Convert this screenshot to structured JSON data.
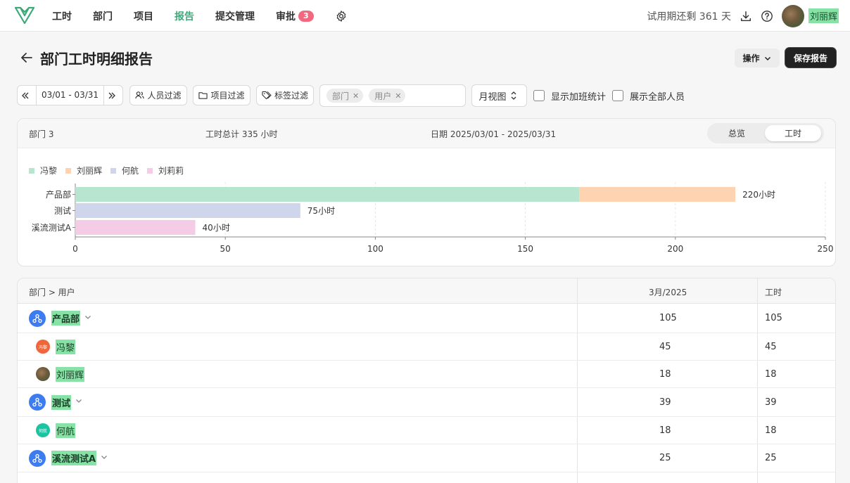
{
  "nav": {
    "items": [
      "工时",
      "部门",
      "项目",
      "报告",
      "提交管理",
      "审批"
    ],
    "active_index": 3,
    "approval_badge": "3",
    "trial_text": "试用期还剩 361 天",
    "user_name": "刘丽辉"
  },
  "page": {
    "title": "部门工时明细报告",
    "ops_label": "操作",
    "save_label": "保存报告"
  },
  "filters": {
    "date_range": "03/01 - 03/31",
    "people_filter": "人员过滤",
    "project_filter": "项目过滤",
    "tag_filter": "标签过滤",
    "chips": [
      "部门",
      "用户"
    ],
    "view_label": "月视图",
    "show_overtime": "显示加班统计",
    "show_all": "展示全部人员"
  },
  "summary": {
    "dept_count": "部门 3",
    "total_hours": "工时总计 335 小时",
    "date_text": "日期 2025/03/01 - 2025/03/31",
    "seg_overview": "总览",
    "seg_hours": "工时"
  },
  "chart_data": {
    "type": "bar",
    "orientation": "horizontal",
    "stacked": true,
    "categories": [
      "产品部",
      "测试",
      "溪流测试A"
    ],
    "series": [
      {
        "name": "冯黎",
        "color": "#b8e5d0",
        "values": [
          168,
          0,
          0
        ]
      },
      {
        "name": "刘丽辉",
        "color": "#fdd3b1",
        "values": [
          52,
          0,
          0
        ]
      },
      {
        "name": "何航",
        "color": "#cfd5ea",
        "values": [
          0,
          75,
          0
        ]
      },
      {
        "name": "刘莉莉",
        "color": "#f5cce6",
        "values": [
          0,
          0,
          40
        ]
      }
    ],
    "data_labels": [
      "220小时",
      "75小时",
      "40小时"
    ],
    "x_ticks": [
      "0",
      "50",
      "100",
      "150",
      "200",
      "250"
    ],
    "xlim": [
      0,
      250
    ],
    "grid": true,
    "legend_position": "top-left"
  },
  "table": {
    "col_name": "部门 > 用户",
    "col_month": "3月/2025",
    "col_hours": "工时",
    "rows": [
      {
        "type": "dept",
        "name": "产品部",
        "month": "105",
        "hours": "105"
      },
      {
        "type": "user",
        "name": "冯黎",
        "avatar_text": "冯黎",
        "avatar_color": "#f0663a",
        "month": "45",
        "hours": "45"
      },
      {
        "type": "user",
        "name": "刘丽辉",
        "avatar_text": "",
        "avatar_color": "#7a6a4a",
        "month": "18",
        "hours": "18"
      },
      {
        "type": "dept",
        "name": "测试",
        "month": "39",
        "hours": "39"
      },
      {
        "type": "user",
        "name": "何航",
        "avatar_text": "何航",
        "avatar_color": "#19c4a0",
        "month": "18",
        "hours": "18"
      },
      {
        "type": "dept",
        "name": "溪流测试A",
        "month": "25",
        "hours": "25"
      }
    ]
  }
}
